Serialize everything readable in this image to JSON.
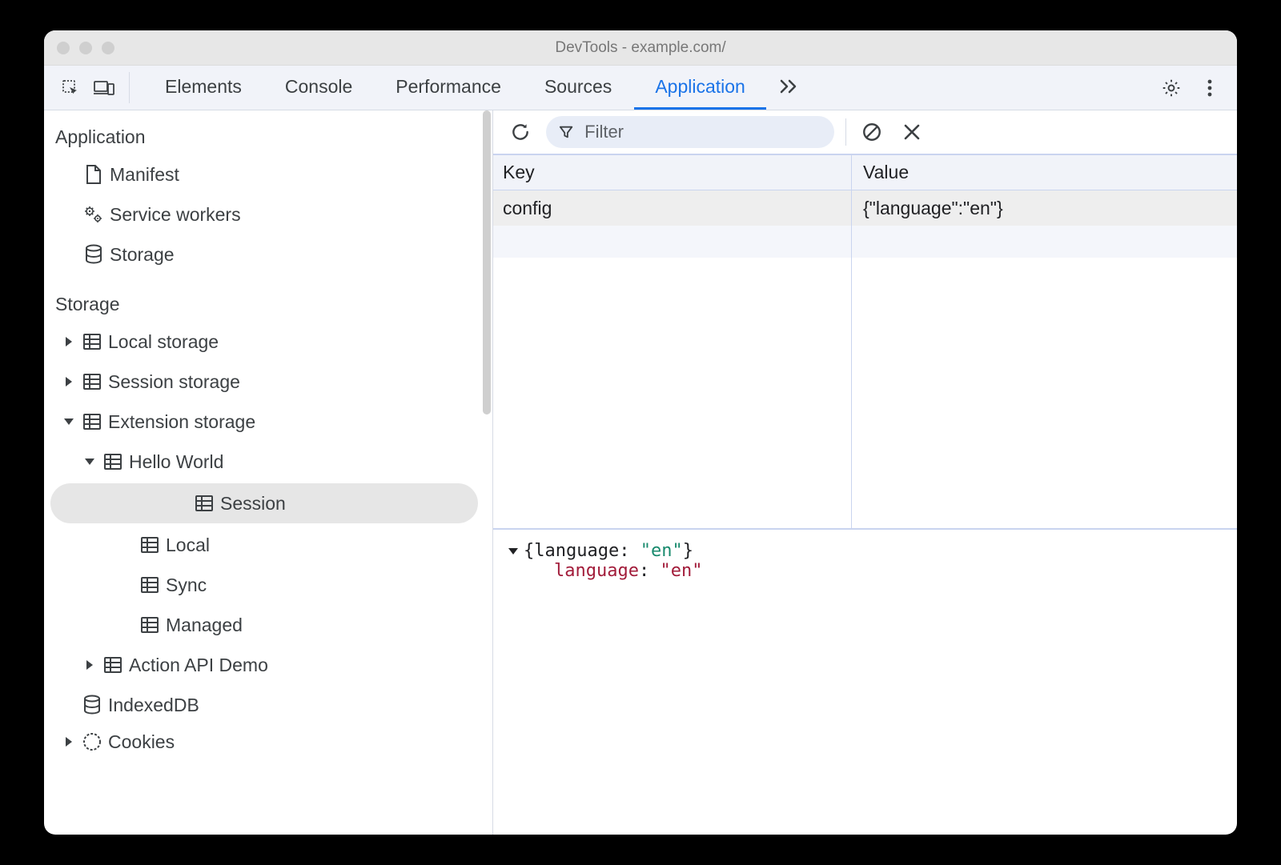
{
  "window": {
    "title": "DevTools - example.com/"
  },
  "tabs": {
    "elements": "Elements",
    "console": "Console",
    "performance": "Performance",
    "sources": "Sources",
    "application": "Application"
  },
  "sidebar": {
    "section_application": "Application",
    "app_items": {
      "manifest": "Manifest",
      "service_workers": "Service workers",
      "storage": "Storage"
    },
    "section_storage": "Storage",
    "storage_items": {
      "local": "Local storage",
      "session": "Session storage",
      "extension": "Extension storage",
      "hello_world": "Hello World",
      "ext_session": "Session",
      "ext_local": "Local",
      "ext_sync": "Sync",
      "ext_managed": "Managed",
      "action_api_demo": "Action API Demo",
      "indexeddb": "IndexedDB",
      "cookies": "Cookies"
    }
  },
  "filter": {
    "placeholder": "Filter"
  },
  "table": {
    "head_key": "Key",
    "head_value": "Value",
    "rows": [
      {
        "key": "config",
        "value": "{\"language\":\"en\"}"
      }
    ]
  },
  "preview": {
    "summary_prefix": "{language: ",
    "summary_value": "\"en\"",
    "summary_suffix": "}",
    "prop_key": "language",
    "prop_value": "\"en\""
  }
}
